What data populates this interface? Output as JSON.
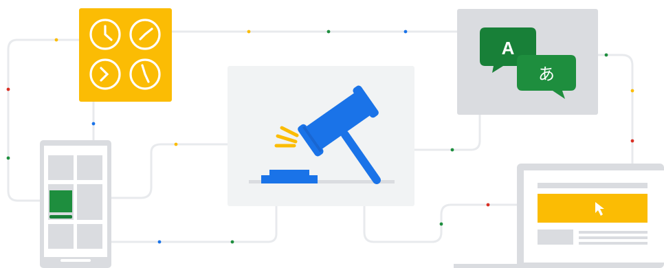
{
  "translate": {
    "latin_letter": "A",
    "japanese_letter": "あ"
  },
  "colors": {
    "blue": "#1a73e8",
    "green": "#1e8e3e",
    "dark_green": "#188038",
    "yellow": "#fbbc04",
    "red": "#d93025",
    "card": "#f1f3f4",
    "grey_card": "#dadce0",
    "line": "#e8eaed"
  },
  "icons": [
    "clock-grid-icon",
    "gavel-icon",
    "translate-icon",
    "mobile-phone-icon",
    "laptop-icon",
    "cursor-icon"
  ]
}
